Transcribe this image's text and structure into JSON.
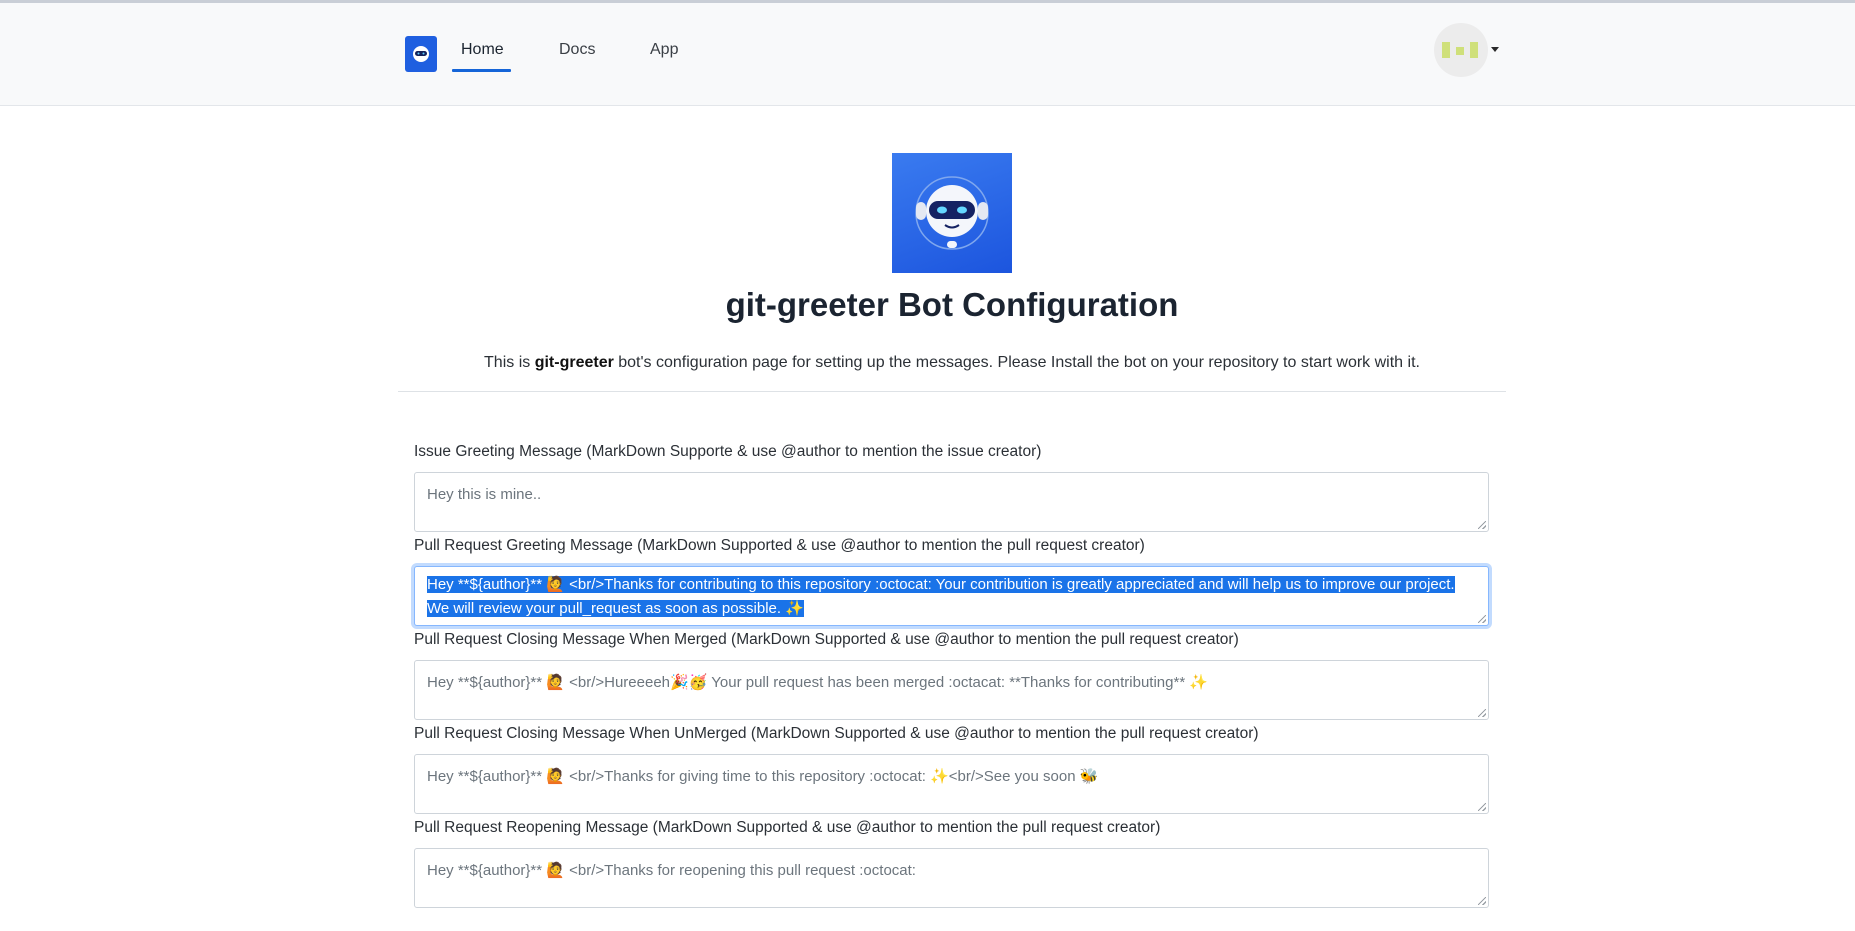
{
  "nav": {
    "links": [
      {
        "label": "Home"
      },
      {
        "label": "Docs"
      },
      {
        "label": "App"
      }
    ]
  },
  "hero": {
    "title": "git-greeter Bot Configuration",
    "desc_prefix": "This is ",
    "desc_bold": "git-greeter",
    "desc_suffix": " bot's configuration page for setting up the messages. Please Install the bot on your repository to start work with it."
  },
  "fields": [
    {
      "label": "Issue Greeting Message (MarkDown Supporte & use @author to mention the issue creator)",
      "value": "Hey this is mine.."
    },
    {
      "label": "Pull Request Greeting Message (MarkDown Supported & use @author to mention the pull request creator)",
      "value": "Hey **${author}** 🙋 <br/>Thanks for contributing to this repository :octocat: Your contribution is greatly appreciated and will help us to improve our project. We will review your pull_request as soon as possible. ✨"
    },
    {
      "label": "Pull Request Closing Message When Merged (MarkDown Supported & use @author to mention the pull request creator)",
      "value": "Hey **${author}** 🙋 <br/>Hureeeeh🎉🥳 Your pull request has been merged :octacat: **Thanks for contributing** ✨"
    },
    {
      "label": "Pull Request Closing Message When UnMerged (MarkDown Supported & use @author to mention the pull request creator)",
      "value": "Hey **${author}** 🙋 <br/>Thanks for giving time to this repository :octocat: ✨<br/>See you soon 🐝"
    },
    {
      "label": "Pull Request Reopening Message (MarkDown Supported & use @author to mention the pull request creator)",
      "value": "Hey **${author}** 🙋 <br/>Thanks for reopening this pull request :octocat:"
    }
  ],
  "colors": {
    "accent": "#1565d8",
    "logo_bg": "#1f5fe0",
    "selection": "#1a73e8"
  },
  "icons": {
    "nav_logo": "robot-icon",
    "hero_logo": "robot-icon",
    "avatar": "identicon-avatar"
  }
}
